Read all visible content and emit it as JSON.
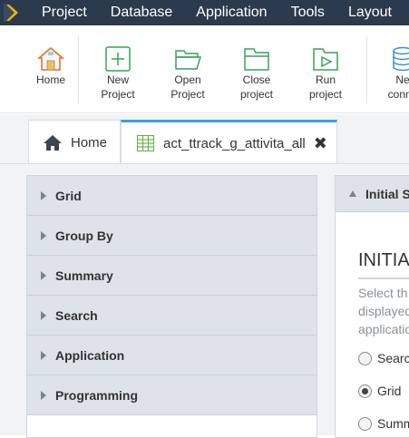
{
  "menubar": {
    "items": [
      "Project",
      "Database",
      "Application",
      "Tools",
      "Layout"
    ]
  },
  "toolbar": {
    "buttons": [
      {
        "line1": "Home",
        "line2": ""
      },
      {
        "line1": "New",
        "line2": "Project"
      },
      {
        "line1": "Open",
        "line2": "Project"
      },
      {
        "line1": "Close",
        "line2": "project"
      },
      {
        "line1": "Run",
        "line2": "project"
      },
      {
        "line1": "Ne",
        "line2": "conne"
      }
    ]
  },
  "tabs": {
    "home_label": "Home",
    "active_label": "act_ttrack_g_attivita_all",
    "close_symbol": "✖"
  },
  "left_panel": {
    "items": [
      "Grid",
      "Group By",
      "Summary",
      "Search",
      "Application",
      "Programming"
    ]
  },
  "right_panel": {
    "header": "Initial S",
    "title": "INITIA",
    "description": [
      "Select th",
      "displayed",
      "applicatio"
    ],
    "options": [
      {
        "label": "Searc",
        "checked": false
      },
      {
        "label": "Grid",
        "checked": true
      },
      {
        "label": "Summ",
        "checked": false
      }
    ]
  },
  "colors": {
    "menubar_bg": "#2b3a4d",
    "logo_accent": "#f5b800",
    "active_tab_accent": "#3aa0df",
    "icon_green": "#3aa05a",
    "accordion_bg": "#dee3ea"
  }
}
